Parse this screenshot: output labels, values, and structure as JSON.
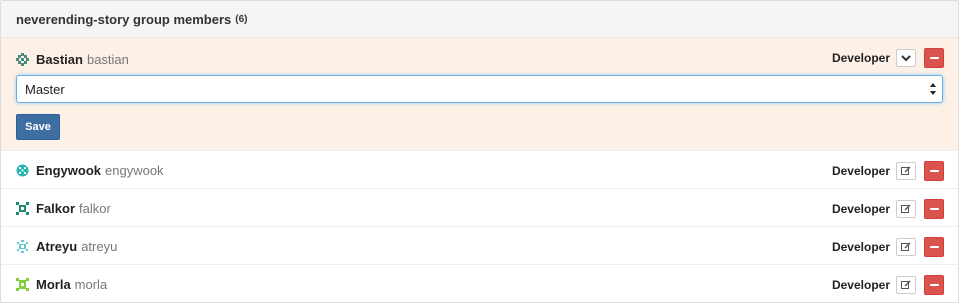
{
  "heading": {
    "title": "neverending-story group members",
    "count": "(6)"
  },
  "editing_member": {
    "name": "Bastian",
    "username": "bastian",
    "role": "Developer",
    "avatar_color": "#4a8a7e",
    "select_value": "Master",
    "save_label": "Save"
  },
  "members": [
    {
      "name": "Engywook",
      "username": "engywook",
      "role": "Developer",
      "avatar_color": "#25b8b0"
    },
    {
      "name": "Falkor",
      "username": "falkor",
      "role": "Developer",
      "avatar_color": "#1f8a7a"
    },
    {
      "name": "Atreyu",
      "username": "atreyu",
      "role": "Developer",
      "avatar_color": "#65c6d0"
    },
    {
      "name": "Morla",
      "username": "morla",
      "role": "Developer",
      "avatar_color": "#7ecf3a"
    }
  ],
  "colors": {
    "danger": "#d9534f",
    "primary": "#3f6ea3",
    "editing_bg": "#fdf1e7"
  }
}
